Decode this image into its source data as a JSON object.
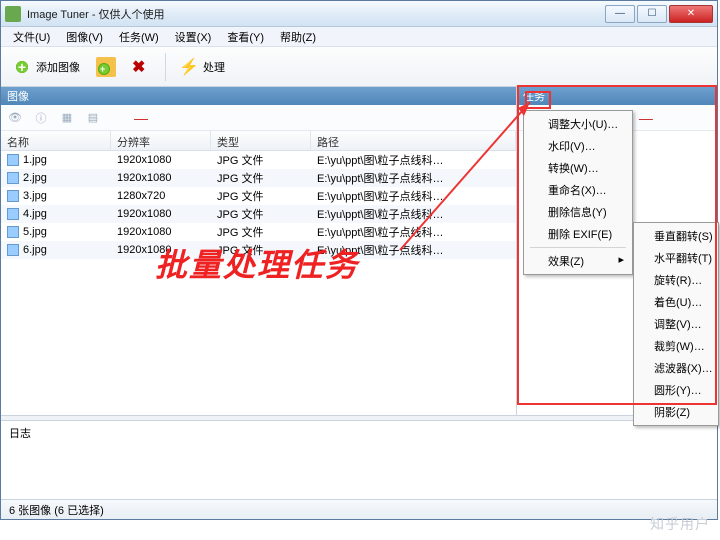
{
  "window": {
    "title": "Image Tuner - 仅供人个使用",
    "btn_min": "—",
    "btn_max": "☐",
    "btn_close": "✕"
  },
  "menubar": [
    "文件(U)",
    "图像(V)",
    "任务(W)",
    "设置(X)",
    "查看(Y)",
    "帮助(Z)"
  ],
  "toolbar": {
    "add_image": "添加图像",
    "process": "处理"
  },
  "pane_image_header": "图像",
  "pane_task_header": "任务",
  "table_headers": {
    "name": "名称",
    "res": "分辨率",
    "type": "类型",
    "path": "路径"
  },
  "rows": [
    {
      "name": "1.jpg",
      "res": "1920x1080",
      "type": "JPG 文件",
      "path": "E:\\yu\\ppt\\图\\粒子点线科…"
    },
    {
      "name": "2.jpg",
      "res": "1920x1080",
      "type": "JPG 文件",
      "path": "E:\\yu\\ppt\\图\\粒子点线科…"
    },
    {
      "name": "3.jpg",
      "res": "1280x720",
      "type": "JPG 文件",
      "path": "E:\\yu\\ppt\\图\\粒子点线科…"
    },
    {
      "name": "4.jpg",
      "res": "1920x1080",
      "type": "JPG 文件",
      "path": "E:\\yu\\ppt\\图\\粒子点线科…"
    },
    {
      "name": "5.jpg",
      "res": "1920x1080",
      "type": "JPG 文件",
      "path": "E:\\yu\\ppt\\图\\粒子点线科…"
    },
    {
      "name": "6.jpg",
      "res": "1920x1080",
      "type": "JPG 文件",
      "path": "E:\\yu\\ppt\\图\\粒子点线科…"
    }
  ],
  "task_menu": {
    "items": [
      "调整大小(U)…",
      "水印(V)…",
      "转换(W)…",
      "重命名(X)…",
      "删除信息(Y)",
      "删除 EXIF(E)"
    ],
    "sub_label": "效果(Z)",
    "sub_items": [
      "垂直翻转(S)",
      "水平翻转(T)",
      "旋转(R)…",
      "着色(U)…",
      "调整(V)…",
      "裁剪(W)…",
      "滤波器(X)…",
      "圆形(Y)…",
      "阴影(Z)"
    ]
  },
  "log_label": "日志",
  "status": "6 张图像 (6 已选择)",
  "annotation_text": "批量处理任务",
  "watermark": "知乎用户"
}
